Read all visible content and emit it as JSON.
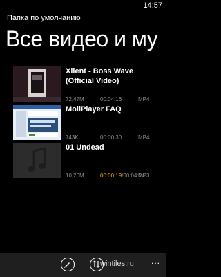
{
  "status_bar": {
    "time": "14:57"
  },
  "header": {
    "subtitle": "Папка по умолчанию",
    "title": "Все видео и му"
  },
  "videos": [
    {
      "title": "Xilent - Boss Wave (Official Video)",
      "size": "72,47M",
      "time": "00:04:16",
      "format": "MP4",
      "thumbnail_icon": "video-thumbnail"
    },
    {
      "title": "MoliPlayer FAQ",
      "size": "743K",
      "time": "00:00:30",
      "format": "MP4",
      "thumbnail_icon": "screenshot-thumbnail"
    },
    {
      "title": "01 Undead",
      "size": "10,20M",
      "time_played": "00:00:19",
      "time_separator": "/",
      "time_total": "00:04:24",
      "format": "MP3",
      "thumbnail_icon": "music-note-thumbnail"
    }
  ],
  "app_bar": {
    "edit_icon": "pencil-icon",
    "sort_icon": "up-down-arrows-icon",
    "more_label": "..."
  },
  "watermark": "wintiles.ru",
  "colors": {
    "accent": "#f0a30a",
    "background": "#000000",
    "meta_text": "#8a8a8a"
  }
}
